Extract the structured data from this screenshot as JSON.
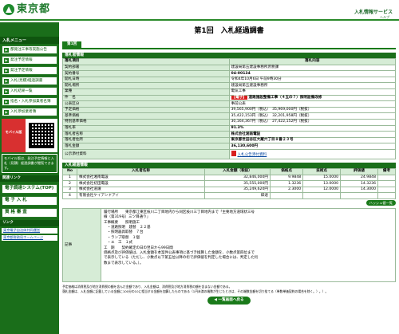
{
  "header": {
    "logo_text": "東京都",
    "service_title": "入札情報サービス",
    "help_link": "ヘルプ"
  },
  "sidebar": {
    "menu_head": "入札メニュー",
    "items": [
      {
        "label": "都発注工事等実施公告"
      },
      {
        "label": "発注予定情報"
      },
      {
        "label": "発注予定情報"
      },
      {
        "label": "入札(見積)経過調書"
      },
      {
        "label": "入札結果一覧"
      },
      {
        "label": "指名・入札参加業者名簿"
      },
      {
        "label": "入札参加業者簿"
      }
    ],
    "mobile_label": "モバイル版",
    "mobile_note": "モバイル版は、発注予定情報と入札（見積）経過調書が閲覧できます。",
    "links_head": "関連リンク",
    "big_buttons": [
      {
        "label": "電子調達システム(TOP)"
      },
      {
        "label": "電 子 入 札"
      },
      {
        "label": "資 格 審 査"
      }
    ],
    "links_head2": "リンク",
    "links": [
      {
        "label": "東京電子自治体共同運営"
      },
      {
        "label": "東京都財務局ホームページ"
      }
    ]
  },
  "main": {
    "page_title": "第1回　入札経過調書",
    "tab_label": "第1回",
    "section_info": "落札者情報",
    "col_item": "落札項目",
    "col_content": "落札内容",
    "rows": [
      {
        "label": "契約部署",
        "value": "建設局第五建設事務所庶務課"
      },
      {
        "label": "契約番号",
        "value": "04-00134"
      },
      {
        "label": "開札日時",
        "value": "令和4年10月6日 午前9時30分"
      },
      {
        "label": "開札場所",
        "value": "建設局第五建設事務所"
      },
      {
        "label": "業種",
        "value": "電気工事"
      }
    ],
    "subject_label": "件　名",
    "subject_badge": "【電子】",
    "subject_text": "道路施設整備工事（４五の７）照明設備改修",
    "rows2": [
      {
        "label": "公表区分",
        "value": "事前公表"
      },
      {
        "label": "予定価格",
        "value": "39,565,900円（税込）　35,969,000円（税抜）"
      },
      {
        "label": "基準価格",
        "value": "35,422,153円（税込）　32,201,958円（税抜）"
      },
      {
        "label": "特別基準価格",
        "value": "30,164,367円（税込）　27,422,152円（税抜）"
      },
      {
        "label": "落札率",
        "value": "91.3%"
      },
      {
        "label": "落札者名称",
        "value": "株式会社湘南電設"
      },
      {
        "label": "落札者住所",
        "value": "東京都世田谷区大蔵六丁目８番２３号"
      },
      {
        "label": "落札金額",
        "value": "36,130,600円"
      }
    ],
    "spec_label": "公示添付資料",
    "spec_link": "入札公告添付資料",
    "section_result": "入札経過情報",
    "res_headers": [
      "No",
      "入札者名称",
      "入札金額（税抜）",
      "価格点",
      "技術点",
      "評価値",
      "備考"
    ],
    "results": [
      {
        "no": "1",
        "name": "株式会社湘南電設",
        "amount": "32,846,000円",
        "price": "9.9848",
        "tech": "15.0000",
        "score": "24.9848",
        "note": ""
      },
      {
        "no": "2",
        "name": "株式会社初田電設",
        "amount": "35,555,000円",
        "price": "1.3236",
        "tech": "13.0000",
        "score": "14.3236",
        "note": ""
      },
      {
        "no": "3",
        "name": "株式会社道譲",
        "amount": "35,249,620円",
        "price": "2.3000",
        "tech": "12.0000",
        "score": "14.3000",
        "note": ""
      },
      {
        "no": "4",
        "name": "有限会社ケイアンドアイ",
        "amount": "辞退",
        "price": "",
        "tech": "",
        "score": "",
        "note": ""
      }
    ],
    "history_button": "ハッシュ値一覧",
    "remarks_label": "記事",
    "remarks_text": "履行場所　　東京都江東区枝川二丁目地内から同区枝川三丁目地内まで「主要地方道環状三号\n線（第319号）三ツ目通り」\n工事概要　　照明施工\n　・道路照明　建替　２２基\n　・照明器具取替　７台\n　・ランプ取替　１個\n　・エ　工　１式\n工　期　　契約確定の日の翌日から99日間\n価格点及び評価値は、入札金額を本案件公表事項に基づき換算した金額を、小数点第四位まで\nで表示している（ただし、小数点以下第五位以降の桁で評価値を判定した場合には、判定した桁\n数まで表示している。）。",
    "footnote": "予定価格は消費税及び地方消費税の額を含んだ金額であり、入札金額は、消費税及び地方消費税の額を含まない金額である。\n落札金額は、入札金額に記載している金額に100分の10に相当する金額を加算したものである（1円未満の端数が生じたときは、その端数金額を切り捨てる（単数単価契約の場合を除く。）。）。",
    "back_button": "一覧画面へ戻る"
  }
}
